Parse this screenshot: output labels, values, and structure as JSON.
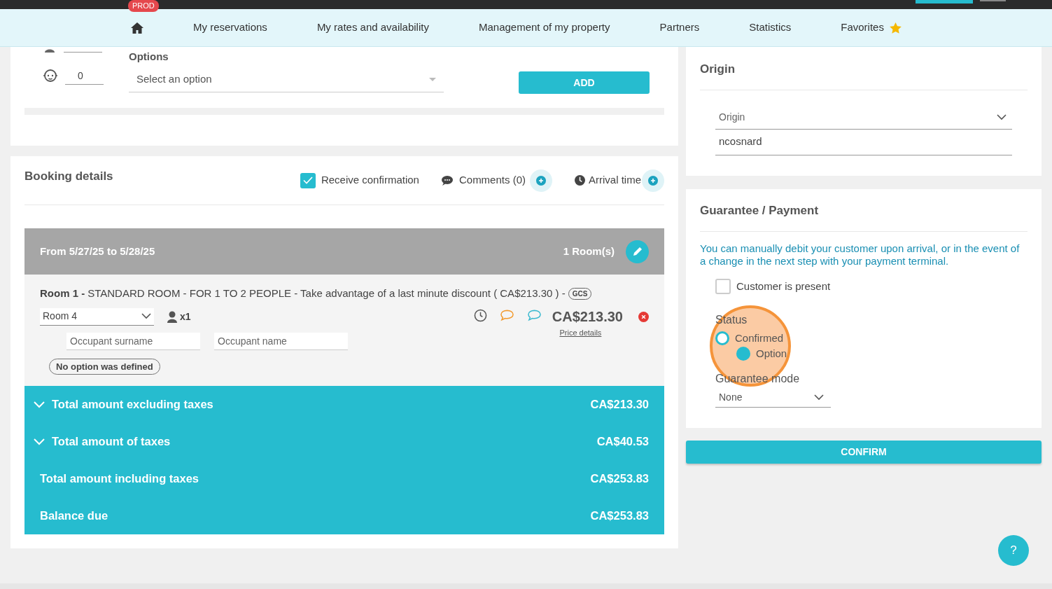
{
  "top_bar": {
    "env_badge": "PROD"
  },
  "nav": {
    "items": [
      {
        "label": "My reservations"
      },
      {
        "label": "My rates and availability"
      },
      {
        "label": "Management of my property"
      },
      {
        "label": "Partners"
      },
      {
        "label": "Statistics"
      },
      {
        "label": "Favorites",
        "starred": true
      }
    ]
  },
  "options_card": {
    "child_count": "0",
    "options_label": "Options",
    "select_placeholder": "Select an option",
    "add_button": "ADD"
  },
  "booking": {
    "title": "Booking details",
    "receive_confirmation": {
      "label": "Receive confirmation",
      "checked": true
    },
    "comments": "Comments (0)",
    "arrival_time": "Arrival time",
    "stay": {
      "dates": "From 5/27/25 to 5/28/25",
      "rooms": "1 Room(s)"
    },
    "room": {
      "title": "Room 1 -",
      "description": "STANDARD ROOM - FOR 1 TO 2 PEOPLE - Take advantage of a last minute discount ( CA$213.30 ) -",
      "tag": "GCS",
      "room_select": "Room 4",
      "occupants": "x1",
      "price": "CA$213.30",
      "price_details": "Price details",
      "surname_placeholder": "Occupant surname",
      "name_placeholder": "Occupant name",
      "option_badge": "No option was defined"
    },
    "totals": [
      {
        "label": "Total amount excluding taxes",
        "value": "CA$213.30",
        "expandable": true
      },
      {
        "label": "Total amount of taxes",
        "value": "CA$40.53",
        "expandable": true
      },
      {
        "label": "Total amount including taxes",
        "value": "CA$253.83",
        "expandable": false
      },
      {
        "label": "Balance due",
        "value": "CA$253.83",
        "expandable": false
      }
    ]
  },
  "origin": {
    "title": "Origin",
    "select_label": "Origin",
    "user": "ncosnard"
  },
  "guarantee": {
    "title": "Guarantee / Payment",
    "info": "You can manually debit your customer upon arrival, or in the event of a change in the next step with your payment terminal.",
    "customer_present": {
      "label": "Customer is present",
      "checked": false
    },
    "status_label": "Status",
    "status_options": [
      {
        "label": "Confirmed",
        "selected": false
      },
      {
        "label": "Option",
        "selected": true
      }
    ],
    "mode_label": "Guarantee mode",
    "mode_value": "None"
  },
  "confirm_button": "CONFIRM",
  "help_button": "?"
}
